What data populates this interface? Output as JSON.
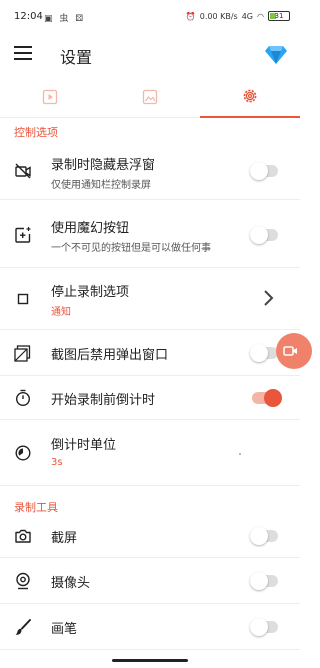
{
  "status_bar": {
    "time": "12:04",
    "notification_icons": "▣ 虫 ⚄",
    "network_rate": "0.00 KB/s",
    "signal": "4G",
    "battery": "31"
  },
  "app_bar": {
    "title": "设置",
    "menu_icon": "menu-icon",
    "premium_icon": "diamond-icon"
  },
  "tabs": [
    {
      "icon": "video-icon",
      "active": false
    },
    {
      "icon": "image-icon",
      "active": false
    },
    {
      "icon": "gear-icon",
      "active": true
    }
  ],
  "sections": {
    "control": {
      "header": "控制选项"
    },
    "tools": {
      "header": "录制工具"
    }
  },
  "control_items": [
    {
      "title": "录制时隐藏悬浮窗",
      "subtitle": "仅使用通知栏控制录屏",
      "control": "toggle",
      "on": false
    },
    {
      "title": "使用魔幻按钮",
      "subtitle": "一个不可见的按钮但是可以做任何事",
      "control": "toggle",
      "on": false
    },
    {
      "title": "停止录制选项",
      "subtitle": "通知",
      "control": "chevron"
    },
    {
      "title": "截图后禁用弹出窗口",
      "control": "toggle",
      "on": false
    },
    {
      "title": "开始录制前倒计时",
      "control": "toggle",
      "on": true
    },
    {
      "title": "倒计时单位",
      "subtitle": "3s",
      "control": "none"
    }
  ],
  "tool_items": [
    {
      "title": "截屏",
      "control": "toggle",
      "on": false
    },
    {
      "title": "摄像头",
      "control": "toggle",
      "on": false
    },
    {
      "title": "画笔",
      "control": "toggle",
      "on": false
    }
  ],
  "colors": {
    "accent": "#e8563c",
    "toggle_off_track": "#dddddd",
    "toggle_on_track": "#f4b5a7",
    "premium": "#2aa4f4",
    "float_button": "#f0826c"
  }
}
